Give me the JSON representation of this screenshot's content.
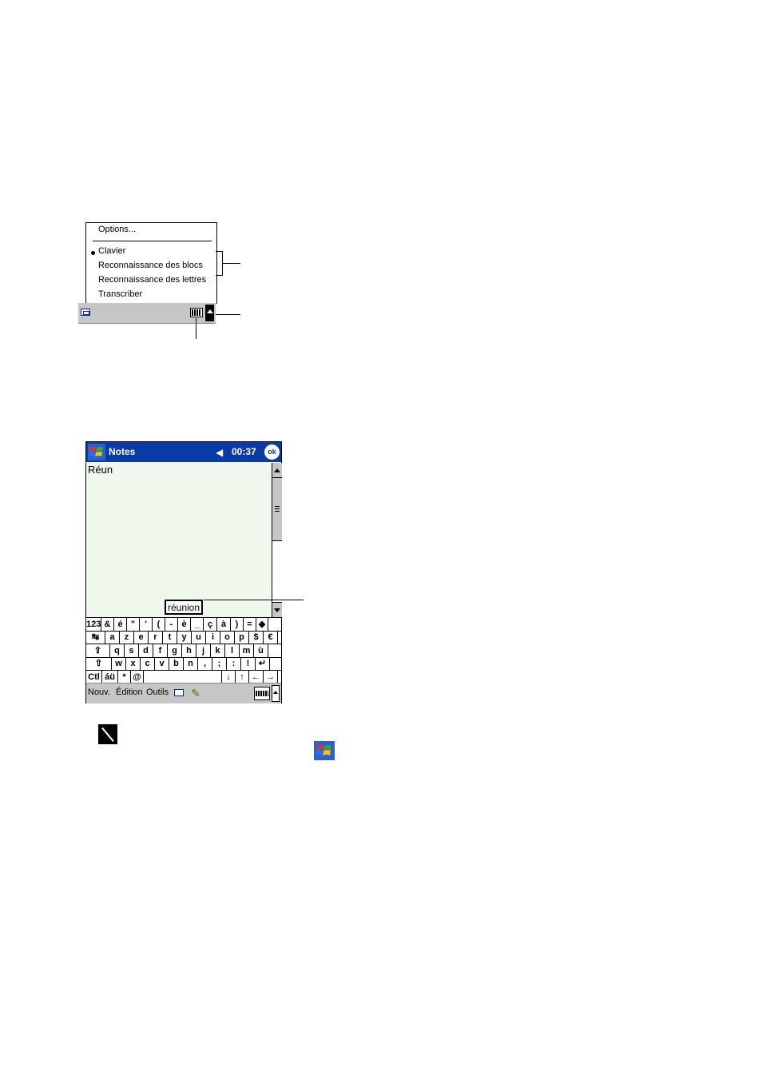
{
  "input_menu": {
    "options_label": "Options...",
    "items": [
      "Clavier",
      "Reconnaissance des blocs",
      "Reconnaissance des lettres",
      "Transcriber"
    ],
    "selected": "Clavier"
  },
  "notes_screen": {
    "app_title": "Notes",
    "clock": "00:37",
    "ok_label": "ok",
    "note_text": "Réun",
    "suggestion": "réunion",
    "keyboard_rows": [
      [
        "123",
        "&",
        "é",
        "\"",
        "'",
        "(",
        "-",
        "è",
        "_",
        "ç",
        "à",
        ")",
        "=",
        "◆"
      ],
      [
        "↹",
        "a",
        "z",
        "e",
        "r",
        "t",
        "y",
        "u",
        "i",
        "o",
        "p",
        "$",
        "€"
      ],
      [
        "⇪",
        "q",
        "s",
        "d",
        "f",
        "g",
        "h",
        "j",
        "k",
        "l",
        "m",
        "ù"
      ],
      [
        "⇧",
        "w",
        "x",
        "c",
        "v",
        "b",
        "n",
        ",",
        ";",
        ":",
        "!",
        "↵"
      ],
      [
        "Ctl",
        "áü",
        "*",
        "@",
        "",
        "↓",
        "↑",
        "←",
        "→"
      ]
    ],
    "menubar": {
      "new": "Nouv.",
      "edit": "Édition",
      "tools": "Outils"
    }
  },
  "colors": {
    "titlebar": "#0a3aa5",
    "bar_gray": "#c6c6c6",
    "note_bg": "#f0f7ec"
  }
}
